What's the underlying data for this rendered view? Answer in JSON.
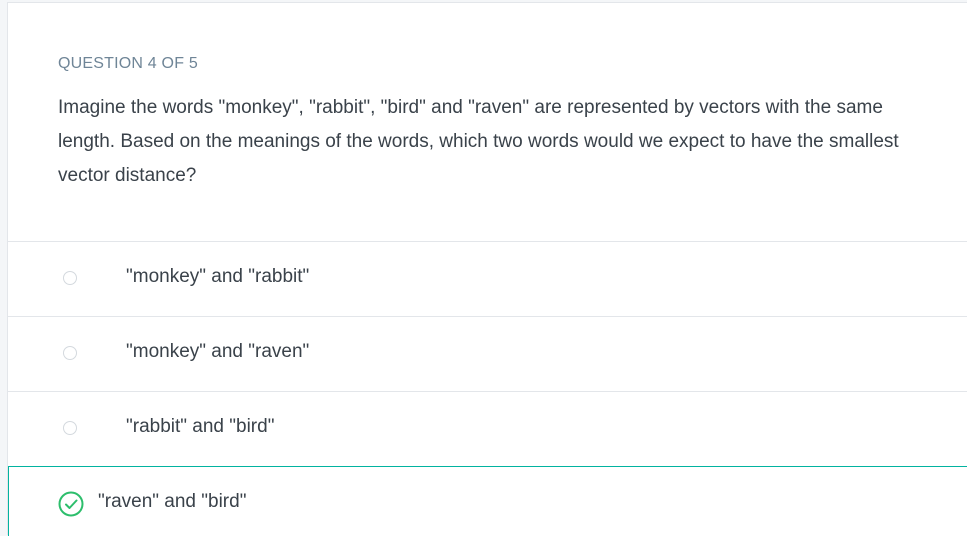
{
  "quiz": {
    "header": "QUESTION 4 OF 5",
    "question": "Imagine the words \"monkey\", \"rabbit\", \"bird\" and \"raven\" are represented by vectors with the same length. Based on the meanings of the words, which two words would we expect to have the smallest vector distance?",
    "options": [
      {
        "label": "\"monkey\" and \"rabbit\"",
        "state": "unselected"
      },
      {
        "label": "\"monkey\" and \"raven\"",
        "state": "unselected"
      },
      {
        "label": "\"rabbit\" and \"bird\"",
        "state": "unselected"
      },
      {
        "label": "\"raven\" and \"bird\"",
        "state": "correct"
      }
    ]
  },
  "colors": {
    "correct_accent": "#2dbe6c",
    "correct_border": "#02b3a0",
    "header_text": "#6f8597",
    "body_text": "#3a424a"
  },
  "icons": {
    "unselected": "radio-empty-icon",
    "correct": "check-circle-icon"
  }
}
